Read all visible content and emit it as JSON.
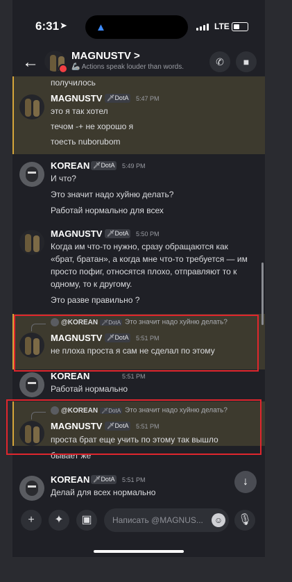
{
  "status_bar": {
    "time": "6:31",
    "network": "LTE"
  },
  "header": {
    "name": "MAGNUSTV",
    "name_suffix": ">",
    "status_text": "Actions speak louder than words.",
    "back_icon": "arrow-left-icon",
    "call_icon": "phone-icon",
    "video_icon": "video-icon"
  },
  "tags": {
    "dota": "DotA"
  },
  "messages": [
    {
      "id": "m0",
      "lines": [
        "получилось"
      ]
    },
    {
      "id": "m1",
      "author": "MAGNUSTV",
      "time": "5:47 PM",
      "lines": [
        "это я так хотел",
        "течом -+ не хорошо я",
        "тоесть nuborubom"
      ]
    },
    {
      "id": "m2",
      "author": "KOREAN",
      "time": "5:49 PM",
      "lines": [
        "И что?",
        "Это значит надо хуйню делать?",
        "Работай нормально для всех"
      ]
    },
    {
      "id": "m3",
      "author": "MAGNUSTV",
      "time": "5:50 PM",
      "lines": [
        "Когда им что-то нужно, сразу обращаются как «брат, братан», а когда мне что-то требуется — им просто пофиг, относятся плохо, отправляют то к одному, то к другому.",
        "Это разве правильно ?"
      ]
    },
    {
      "id": "m4",
      "author": "MAGNUSTV",
      "time": "5:51 PM",
      "reply_to": {
        "author": "@KOREAN",
        "text": "Это значит надо хуйню делать?"
      },
      "lines": [
        "не плоха проста я сам не сделал по этому"
      ]
    },
    {
      "id": "m5",
      "author": "KOREAN",
      "time": "5:51 PM",
      "lines": [
        "Работай нормально"
      ]
    },
    {
      "id": "m6",
      "author": "MAGNUSTV",
      "time": "5:51 PM",
      "reply_to": {
        "author": "@KOREAN",
        "text": "Это значит надо хуйню делать?"
      },
      "lines": [
        "проста брат еще учить по этому так вышло",
        "бывает же"
      ]
    },
    {
      "id": "m7",
      "author": "KOREAN",
      "time": "5:51 PM",
      "lines": [
        "Делай для всех нормально"
      ]
    }
  ],
  "composer": {
    "placeholder": "Написать @MAGNUS...",
    "icons": [
      "plus-icon",
      "gamepad-icon",
      "gift-icon",
      "emoji-icon",
      "mic-icon"
    ]
  },
  "jump_icon": "arrow-down-icon"
}
